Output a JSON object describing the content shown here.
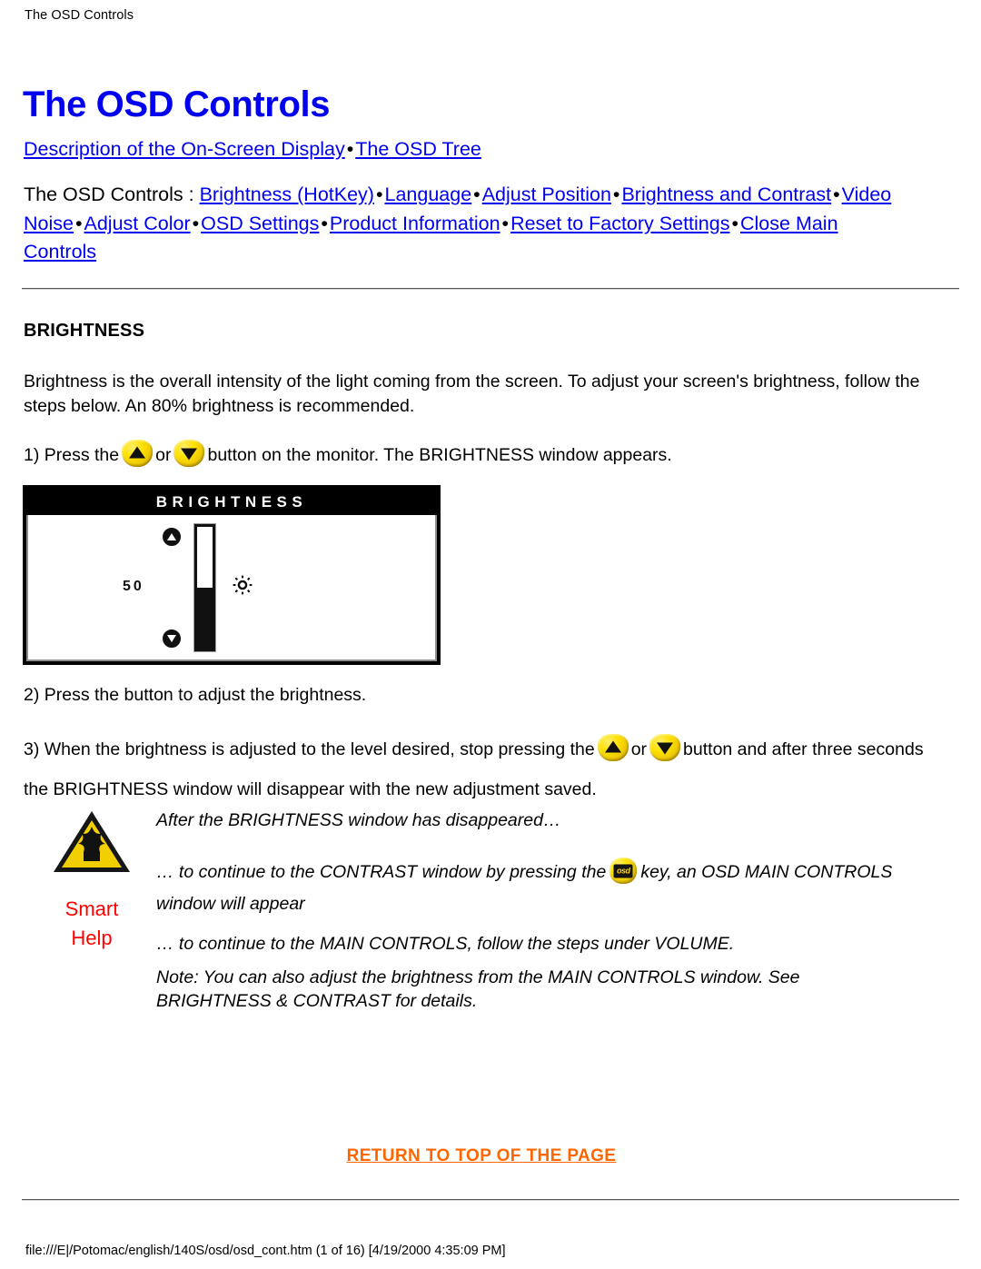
{
  "header": {
    "breadcrumb": "The OSD Controls"
  },
  "title": "The OSD Controls",
  "nav": {
    "row1": {
      "links": [
        "Description of the On-Screen Display",
        "The OSD Tree"
      ],
      "separator": "•"
    },
    "row2": {
      "prefix": "The OSD Controls : ",
      "links": [
        "Brightness (HotKey)",
        "Language",
        "Adjust Position",
        "Brightness and Contrast",
        "Video Noise",
        "Adjust Color",
        "OSD Settings",
        "Product Information",
        "Reset to Factory Settings",
        "Close Main Controls"
      ],
      "separator": "•"
    }
  },
  "section": {
    "heading": "BRIGHTNESS",
    "intro": "Brightness is the overall intensity of the light coming from the screen. To adjust your screen's brightness, follow the steps below. An 80% brightness is recommended.",
    "step1_a": "1) Press the",
    "step1_b": "or",
    "step1_c": "button on the monitor. The BRIGHTNESS window appears.",
    "step2": "2) Press the button to adjust the brightness.",
    "step3_a": "3) When the brightness is adjusted to the level desired, stop pressing the",
    "step3_b": "or",
    "step3_c": "button and after three seconds the BRIGHTNESS window will disappear with the new adjustment saved."
  },
  "osd_window": {
    "title": "BRIGHTNESS",
    "value": "50",
    "fill_percent": 50,
    "up_icon": "triangle-up-icon",
    "down_icon": "triangle-down-icon",
    "symbol_icon": "sun-brightness-icon"
  },
  "smart_help": {
    "icon": "warning-triangle-icon",
    "label_line1": "Smart",
    "label_line2": "Help",
    "label_color": "#ff0000",
    "paragraphs": {
      "p1": "After the BRIGHTNESS window has disappeared…",
      "p2_a": "… to continue to the CONTRAST window by pressing the",
      "p2_b": "key, an OSD MAIN CONTROLS window will appear",
      "p3": "… to continue to the MAIN CONTROLS, follow the steps under VOLUME.",
      "p4": "Note: You can also adjust the brightness from the MAIN CONTROLS window. See BRIGHTNESS & CONTRAST for details."
    }
  },
  "return_top": {
    "label": "RETURN TO TOP OF THE PAGE",
    "color": "#ff6600"
  },
  "footer": {
    "path": "file:///E|/Potomac/english/140S/osd/osd_cont.htm (1 of 16) [4/19/2000 4:35:09 PM]"
  },
  "icons": {
    "osd_key_label": "osd"
  },
  "colors": {
    "link": "#0000ee",
    "title": "#0000ee",
    "accent_orange": "#ff6600",
    "button_yellow": "#ffe000",
    "warning_yellow": "#f5d400"
  }
}
